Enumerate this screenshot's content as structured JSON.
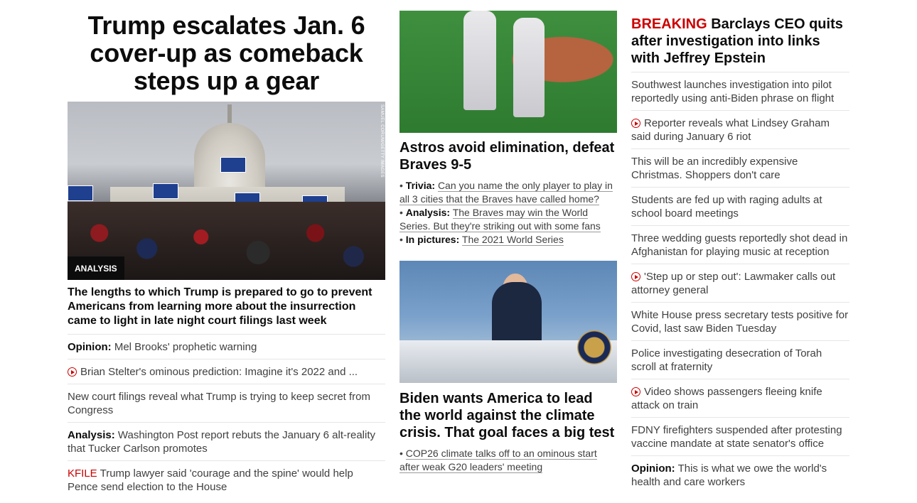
{
  "lead": {
    "headline": "Trump escalates Jan. 6 cover-up as comeback steps up a gear",
    "photo_credit": "SAMUEL CORUM/GETTY IMAGES",
    "badge": "ANALYSIS",
    "summary": "The lengths to which Trump is prepared to go to prevent Americans from learning more about the insurrection came to light in late night court filings last week",
    "items": [
      {
        "prefix": "Opinion:",
        "text": "Mel Brooks' prophetic warning"
      },
      {
        "video": true,
        "text": "Brian Stelter's ominous prediction: Imagine it's 2022 and ..."
      },
      {
        "text": "New court filings reveal what Trump is trying to keep secret from Congress"
      },
      {
        "prefix": "Analysis:",
        "text": "Washington Post report rebuts the January 6 alt-reality that Tucker Carlson promotes"
      },
      {
        "kfile": "KFILE",
        "text": "Trump lawyer said 'courage and the spine' would help Pence send election to the House"
      }
    ]
  },
  "astros": {
    "headline": "Astros avoid elimination, defeat Braves 9-5",
    "bullets": [
      {
        "label": "Trivia:",
        "text": "Can you name the only player to play in all 3 cities that the Braves have called home?"
      },
      {
        "label": "Analysis:",
        "text": "The Braves may win the World Series. But they're striking out with some fans"
      },
      {
        "label": "In pictures:",
        "text": "The 2021 World Series"
      }
    ]
  },
  "climate": {
    "headline": "Biden wants America to lead the world against the climate crisis. That goal faces a big test",
    "bullet": "COP26 climate talks off to an ominous start after weak G20 leaders' meeting"
  },
  "right": {
    "breaking_label": "BREAKING",
    "breaking_text": "Barclays CEO quits after investigation into links with Jeffrey Epstein",
    "items": [
      {
        "text": "Southwest launches investigation into pilot reportedly using anti-Biden phrase on flight"
      },
      {
        "video": true,
        "text": "Reporter reveals what Lindsey Graham said during January 6 riot"
      },
      {
        "text": "This will be an incredibly expensive Christmas. Shoppers don't care"
      },
      {
        "text": "Students are fed up with raging adults at school board meetings"
      },
      {
        "text": "Three wedding guests reportedly shot dead in Afghanistan for playing music at reception"
      },
      {
        "video": true,
        "text": "'Step up or step out': Lawmaker calls out attorney general"
      },
      {
        "text": "White House press secretary tests positive for Covid, last saw Biden Tuesday"
      },
      {
        "text": "Police investigating desecration of Torah scroll at fraternity"
      },
      {
        "video": true,
        "text": "Video shows passengers fleeing knife attack on train"
      },
      {
        "text": "FDNY firefighters suspended after protesting vaccine mandate at state senator's office"
      },
      {
        "prefix": "Opinion:",
        "text": "This is what we owe the world's health and care workers"
      }
    ]
  }
}
